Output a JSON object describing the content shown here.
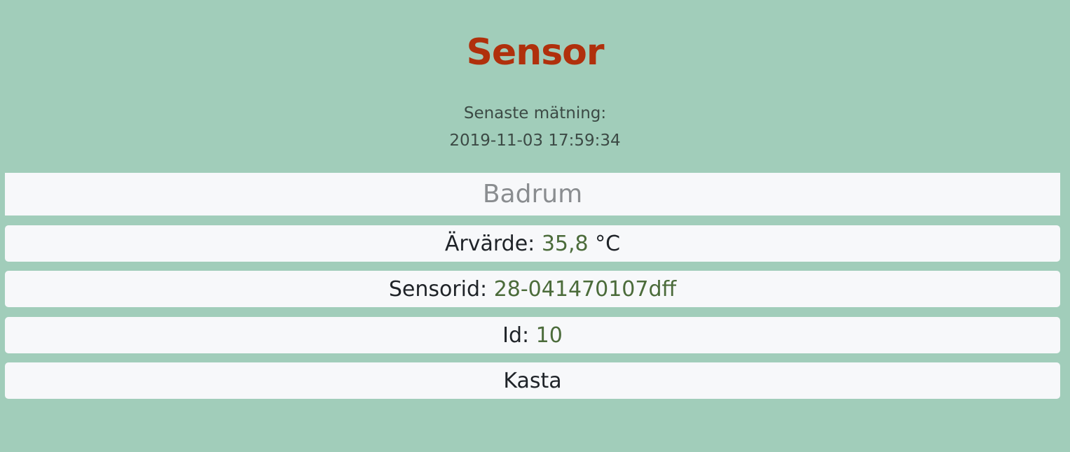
{
  "page": {
    "title": "Sensor",
    "last_measure_label": "Senaste mätning:",
    "last_measure_time": "2019-11-03 17:59:34"
  },
  "sensor": {
    "name": "Badrum",
    "actual_value_label": "Ärvärde:",
    "actual_value": "35,8",
    "actual_value_unit": "°C",
    "sensor_id_label": "Sensorid:",
    "sensor_id": "28-041470107dff",
    "id_label": "Id:",
    "id": "10",
    "discard_label": "Kasta"
  },
  "colors": {
    "background": "#a1cdba",
    "title": "#b0300c",
    "value": "#4b6b3a"
  }
}
